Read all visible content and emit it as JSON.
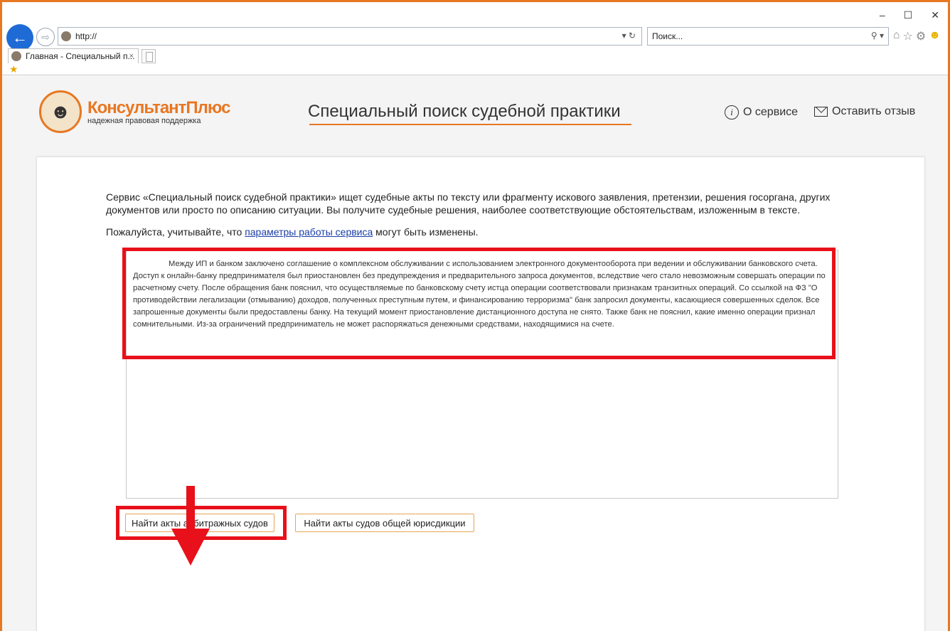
{
  "browser": {
    "address": "http://",
    "search_placeholder": "Поиск...",
    "tab_title": "Главная - Специальный п...",
    "tab_close": "×",
    "win_min": "–",
    "win_max": "☐",
    "win_close": "✕"
  },
  "header": {
    "logo_main": "КонсультантПлюс",
    "logo_sub": "надежная правовая поддержка",
    "title": "Специальный поиск судебной практики",
    "nav_about": "О сервисе",
    "nav_feedback": "Оставить отзыв"
  },
  "main": {
    "intro": "Сервис «Специальный поиск судебной практики» ищет судебные акты по тексту или фрагменту искового заявления, претензии, решения госоргана, других документов или просто по описанию ситуации. Вы получите судебные решения, наиболее соответствующие обстоятельствам, изложенным в тексте.",
    "note_before": "Пожалуйста, учитывайте, что ",
    "note_link": "параметры работы сервиса",
    "note_after": " могут быть изменены.",
    "query_text": "Между ИП и банком заключено соглашение о комплексном обслуживании с использованием электронного документооборота при ведении и обслуживании банковского счета. Доступ к онлайн-банку предпринимателя был приостановлен без предупреждения и предварительного запроса документов, вследствие чего стало невозможным совершать операции по расчетному счету. После обращения банк пояснил, что осуществляемые по банковскому счету истца операции соответствовали признакам транзитных операций. Со ссылкой на ФЗ \"О противодействии легализации (отмыванию) доходов, полученных преступным путем, и финансированию терроризма\" банк запросил документы, касающиеся совершенных сделок. Все запрошенные документы были предоставлены банку. На текущий момент приостановление дистанционного доступа не снято. Также банк не пояснил, какие именно операции признал сомнительными. Из-за ограничений предприниматель не может распоряжаться денежными средствами, находящимися на счете.",
    "button_arbitration": "Найти акты арбитражных судов",
    "button_general": "Найти акты судов общей юрисдикции"
  },
  "colors": {
    "accent": "#e87722",
    "highlight": "#e8101a",
    "link": "#1a3ea8"
  }
}
